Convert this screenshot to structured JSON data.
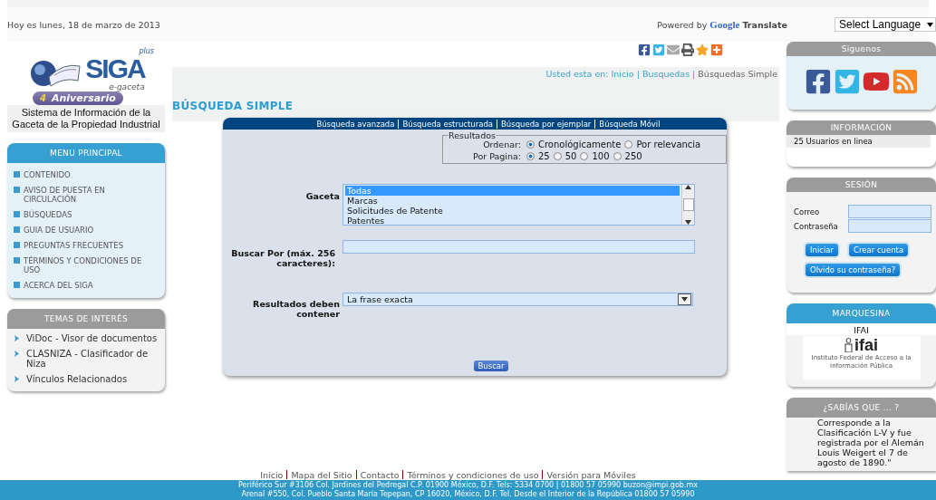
{
  "top_bar": {
    "date": "Hoy es lunes, 18 de marzo de 2013",
    "powered_by": "Powered by",
    "translate_brand": "Google",
    "translate_word": "Translate",
    "language_select": "Select Language"
  },
  "logo": {
    "name": "SIGA",
    "plus": "plus",
    "subtitle": "e-gaceta",
    "badge_number": "4",
    "anniversary": "Aniversario",
    "caption": "Sistema de Información de la Gaceta de la Propiedad Industrial"
  },
  "main_menu": {
    "title": "MENU PRINCIPAL",
    "items": [
      {
        "label": "CONTENIDO"
      },
      {
        "label": "AVISO DE PUESTA EN CIRCULACIÓN"
      },
      {
        "label": "BÚSQUEDAS"
      },
      {
        "label": "GUIA DE USUARIO"
      },
      {
        "label": "PREGUNTAS FRECUENTES"
      },
      {
        "label": "TÉRMINOS Y CONDICIONES DE USO"
      },
      {
        "label": "ACERCA DEL SIGA"
      }
    ]
  },
  "topics": {
    "title": "TEMAS DE INTERÉS",
    "items": [
      {
        "label": "ViDoc - Visor de documentos"
      },
      {
        "label": "CLASNIZA - Clasificador de Niza"
      },
      {
        "label": "Vínculos Relacionados"
      }
    ]
  },
  "share_icons": [
    {
      "kind": "facebook"
    },
    {
      "kind": "twitter"
    },
    {
      "kind": "mail"
    },
    {
      "kind": "print"
    },
    {
      "kind": "favorite"
    },
    {
      "kind": "more"
    }
  ],
  "breadcrumb": {
    "prefix": "Usted esta en:",
    "separator": "|",
    "links": [
      "Inicio",
      "Busquedas"
    ],
    "current": "Búsquedas Simple"
  },
  "page_title": "BÚSQUEDA SIMPLE",
  "search_tabs": [
    "Búsqueda avanzada",
    "Búsqueda estructurada",
    "Búsqueda por ejemplar",
    "Búsqueda Móvil"
  ],
  "results_options": {
    "legend": "Resultados",
    "order": {
      "label": "Ordenar:",
      "options": [
        {
          "label": "Cronológicamente",
          "selected": true
        },
        {
          "label": "Por relevancia",
          "selected": false
        }
      ]
    },
    "per_page": {
      "label": "Por Pagina:",
      "options": [
        {
          "label": "25",
          "selected": true
        },
        {
          "label": "50",
          "selected": false
        },
        {
          "label": "100",
          "selected": false
        },
        {
          "label": "250",
          "selected": false
        }
      ]
    }
  },
  "gaceta": {
    "label": "Gaceta",
    "options": [
      {
        "label": "Todas",
        "selected": true
      },
      {
        "label": "Marcas",
        "selected": false
      },
      {
        "label": "Solicitudes de Patente",
        "selected": false
      },
      {
        "label": "Patentes",
        "selected": false
      }
    ]
  },
  "search_by": {
    "label": "Buscar Por (máx. 256 caracteres):"
  },
  "must_contain": {
    "label": "Resultados deben contener",
    "value": "La frase exacta"
  },
  "search_button": "Buscar",
  "follow": {
    "title": "Siguenos",
    "icons": [
      {
        "kind": "facebook"
      },
      {
        "kind": "twitter"
      },
      {
        "kind": "youtube"
      },
      {
        "kind": "rss"
      }
    ]
  },
  "information": {
    "title": "INFORMACIÓN",
    "text": "25 Usuarios en linea"
  },
  "session": {
    "title": "SESIÓN",
    "email_label": "Correo",
    "password_label": "Contraseña",
    "login_button": "Iniciar",
    "create_button": "Crear cuenta",
    "forgot_button": "Olvido su contraseña?"
  },
  "marquee": {
    "title": "MARQUESINA",
    "item_title": "IFAI",
    "logo_word": "ifai",
    "logo_caption": "Instituto Federal de Acceso a la Información Pública"
  },
  "did_you_know": {
    "title": "¿SABÍAS QUE ... ?",
    "text": "Corresponde a la Clasificación L-V y fue registrada por el Alemán Louis Weigert el 7 de agosto de 1890.\""
  },
  "footer": {
    "links": [
      "Inicio",
      "Mapa del Sitio",
      "Contacto",
      "Términos y condiciones de uso",
      "Versión para Móviles"
    ],
    "address_lines": [
      "Periférico Sur #3106 Col. Jardines del Pedregal C.P. 01900 México, D.F. Tels: 5334 0700 | 01800 57 05990 buzon@impi.gob.mx",
      "Arenal #550, Col. Pueblo Santa María Tepepan, CP 16020, México, D.F. Tel. Desde el Interior de la República 01800 57 05990"
    ]
  }
}
